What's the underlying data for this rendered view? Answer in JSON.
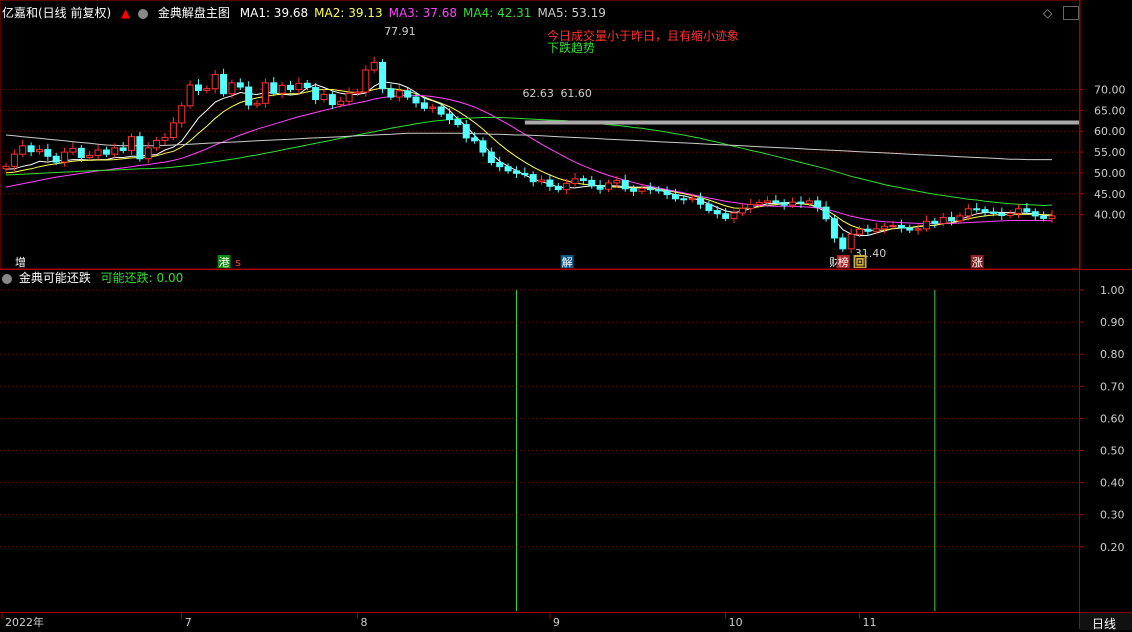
{
  "header": {
    "stock": "亿嘉和(日线 前复权)",
    "indicator": "金典解盘主图",
    "ma": [
      {
        "label": "MA1: 39.68",
        "color": "#ffffff"
      },
      {
        "label": "MA2: 39.13",
        "color": "#ffff55"
      },
      {
        "label": "MA3: 37.68",
        "color": "#ff44ff"
      },
      {
        "label": "MA4: 42.31",
        "color": "#33dd33"
      },
      {
        "label": "MA5: 53.19",
        "color": "#cccccc"
      }
    ]
  },
  "sub_header": {
    "indicator": "金典可能还跌",
    "value_label": "可能还跌: 0.00"
  },
  "annotations": {
    "notice_red": "今日成交量小于昨日，且有缩小迹象",
    "notice_green": "下跌趋势",
    "high_label": "77.91",
    "low_label": "31.40",
    "band_label_1": "62.63",
    "band_label_2": "61.60"
  },
  "markers": [
    {
      "text": "增",
      "color": "#ffffff",
      "bg": "#000000",
      "at": "2022-06-03"
    },
    {
      "text": "港",
      "color": "#ffffff",
      "bg": "#118811",
      "at": "2022-07-08"
    },
    {
      "text": "s",
      "color": "#ff4444",
      "bg": "#000000",
      "at": "2022-07-12"
    },
    {
      "text": "解",
      "color": "#ffffff",
      "bg": "#115588",
      "at": "2022-09-05"
    },
    {
      "text": "财",
      "color": "#ffffff",
      "bg": "#000000",
      "at": "2022-10-27"
    },
    {
      "text": "榜",
      "color": "#ffffff",
      "bg": "#aa2222",
      "at": "2022-10-28"
    },
    {
      "text": "回",
      "color": "#000000",
      "bg": "#ccaa44",
      "at": "2022-11-01"
    },
    {
      "text": "涨",
      "color": "#ffffff",
      "bg": "#882222",
      "at": "2022-11-21"
    }
  ],
  "date_axis": {
    "labels": [
      "2022年",
      "7",
      "8",
      "9",
      "10",
      "11"
    ],
    "right_label": "日线"
  },
  "chart_data": [
    {
      "type": "candlestick",
      "title": "金典解盘主图",
      "yticks": [
        40,
        45,
        50,
        55,
        60,
        65,
        70
      ],
      "ytick_labels": [
        "40.00",
        "45.00",
        "50.00",
        "55.00",
        "60.00",
        "65.00",
        "70.00"
      ],
      "ylim": [
        29.5,
        80.5
      ],
      "x": [
        "2022-06-01",
        "2022-06-02",
        "2022-06-06",
        "2022-06-07",
        "2022-06-08",
        "2022-06-09",
        "2022-06-10",
        "2022-06-13",
        "2022-06-14",
        "2022-06-15",
        "2022-06-16",
        "2022-06-17",
        "2022-06-20",
        "2022-06-21",
        "2022-06-22",
        "2022-06-23",
        "2022-06-24",
        "2022-06-27",
        "2022-06-28",
        "2022-06-29",
        "2022-06-30",
        "2022-07-01",
        "2022-07-04",
        "2022-07-05",
        "2022-07-06",
        "2022-07-07",
        "2022-07-08",
        "2022-07-11",
        "2022-07-12",
        "2022-07-13",
        "2022-07-14",
        "2022-07-15",
        "2022-07-18",
        "2022-07-19",
        "2022-07-20",
        "2022-07-21",
        "2022-07-22",
        "2022-07-25",
        "2022-07-26",
        "2022-07-27",
        "2022-07-28",
        "2022-07-29",
        "2022-08-01",
        "2022-08-02",
        "2022-08-03",
        "2022-08-04",
        "2022-08-05",
        "2022-08-08",
        "2022-08-09",
        "2022-08-10",
        "2022-08-11",
        "2022-08-12",
        "2022-08-15",
        "2022-08-16",
        "2022-08-17",
        "2022-08-18",
        "2022-08-19",
        "2022-08-22",
        "2022-08-23",
        "2022-08-24",
        "2022-08-25",
        "2022-08-26",
        "2022-08-29",
        "2022-08-30",
        "2022-08-31",
        "2022-09-01",
        "2022-09-02",
        "2022-09-05",
        "2022-09-06",
        "2022-09-07",
        "2022-09-08",
        "2022-09-09",
        "2022-09-13",
        "2022-09-14",
        "2022-09-15",
        "2022-09-16",
        "2022-09-19",
        "2022-09-20",
        "2022-09-21",
        "2022-09-22",
        "2022-09-23",
        "2022-09-26",
        "2022-09-27",
        "2022-09-28",
        "2022-09-29",
        "2022-09-30",
        "2022-10-10",
        "2022-10-11",
        "2022-10-12",
        "2022-10-13",
        "2022-10-14",
        "2022-10-17",
        "2022-10-18",
        "2022-10-19",
        "2022-10-20",
        "2022-10-21",
        "2022-10-24",
        "2022-10-25",
        "2022-10-26",
        "2022-10-27",
        "2022-10-28",
        "2022-10-31",
        "2022-11-01",
        "2022-11-02",
        "2022-11-03",
        "2022-11-04",
        "2022-11-07",
        "2022-11-08",
        "2022-11-09",
        "2022-11-10",
        "2022-11-11",
        "2022-11-14",
        "2022-11-15",
        "2022-11-16",
        "2022-11-17",
        "2022-11-18",
        "2022-11-21",
        "2022-11-22",
        "2022-11-23",
        "2022-11-24",
        "2022-11-25",
        "2022-11-28",
        "2022-11-29",
        "2022-11-30",
        "2022-12-01",
        "2022-12-02"
      ],
      "close": [
        51.6,
        54.5,
        56.5,
        55.1,
        55.6,
        54.0,
        52.6,
        55.0,
        55.9,
        53.7,
        54.2,
        55.5,
        54.5,
        56.0,
        55.4,
        58.7,
        53.4,
        56.0,
        57.8,
        58.5,
        62.0,
        66.1,
        71.1,
        69.8,
        70.2,
        73.6,
        69.0,
        71.6,
        70.6,
        66.3,
        66.7,
        71.6,
        69.1,
        71.0,
        70.0,
        71.5,
        70.5,
        67.6,
        68.8,
        66.4,
        67.2,
        69.1,
        69.4,
        74.7,
        76.5,
        70.2,
        68.2,
        69.7,
        68.2,
        66.8,
        65.5,
        65.8,
        64.1,
        62.8,
        61.6,
        58.4,
        57.7,
        55.0,
        52.5,
        51.5,
        50.5,
        49.9,
        49.6,
        47.9,
        48.3,
        46.8,
        46.0,
        47.5,
        48.6,
        48.2,
        46.9,
        46.1,
        47.6,
        48.2,
        46.2,
        45.6,
        46.3,
        46.0,
        45.7,
        44.8,
        43.8,
        43.6,
        43.9,
        42.5,
        41.0,
        40.2,
        39.1,
        40.4,
        41.5,
        42.4,
        42.9,
        43.3,
        42.9,
        42.3,
        43.0,
        42.7,
        43.3,
        41.8,
        39.0,
        34.4,
        31.8,
        35.3,
        36.5,
        36.0,
        36.6,
        37.2,
        37.4,
        36.8,
        36.3,
        36.6,
        38.4,
        37.9,
        39.3,
        38.5,
        39.7,
        41.4,
        41.2,
        40.6,
        40.3,
        39.8,
        40.3,
        41.4,
        40.7,
        39.7,
        39.1,
        39.7
      ],
      "ma_series": [
        {
          "label": "MA1",
          "color": "#ffffff",
          "values": [
            50.9,
            51.0,
            51.6,
            52.0,
            52.8,
            52.6,
            53.0,
            52.9,
            53.2,
            53.2,
            53.1,
            53.2,
            53.2,
            53.7,
            53.7,
            54.0,
            54.0,
            54.3,
            54.4,
            55.5,
            56.2,
            57.6,
            60.4,
            63.2,
            65.0,
            67.0,
            67.9,
            68.5,
            69.3,
            69.0,
            68.8,
            69.3,
            69.2,
            68.9,
            68.7,
            68.9,
            70.4,
            71.2,
            70.5,
            69.7,
            69.1,
            68.8,
            68.8,
            69.2,
            70.8,
            71.9,
            71.6,
            71.3,
            70.5,
            69.3,
            67.9,
            67.3,
            66.5,
            65.0,
            62.9,
            61.2,
            59.0,
            56.9,
            54.6,
            52.8,
            51.6,
            50.6,
            49.5,
            48.6,
            47.9,
            47.3,
            46.6,
            46.5,
            46.4,
            46.7,
            46.9,
            47.0,
            46.9,
            46.9,
            46.7,
            46.6,
            46.6,
            46.6,
            46.0,
            45.3,
            44.8,
            44.5,
            44.0,
            43.4,
            42.6,
            41.7,
            40.9,
            40.5,
            40.8,
            41.5,
            42.1,
            42.6,
            42.7,
            42.9,
            42.9,
            42.6,
            42.4,
            41.7,
            40.6,
            38.7,
            36.4,
            35.3,
            35.0,
            35.0,
            35.6,
            36.1,
            36.7,
            36.8,
            36.9,
            37.2,
            37.4,
            37.4,
            37.9,
            38.0,
            38.9,
            39.5,
            40.2,
            40.5,
            40.6,
            40.5,
            40.5,
            40.4,
            40.3,
            40.2,
            39.9,
            39.7
          ]
        },
        {
          "label": "MA2",
          "color": "#ffff55",
          "values": [
            50.0,
            50.2,
            50.6,
            51.0,
            51.5,
            51.9,
            52.2,
            52.5,
            52.8,
            53.0,
            53.0,
            53.1,
            53.1,
            53.2,
            53.4,
            53.6,
            53.7,
            53.8,
            54.1,
            54.7,
            55.2,
            56.2,
            57.7,
            59.5,
            61.2,
            63.1,
            64.7,
            65.9,
            66.9,
            67.5,
            68.0,
            68.4,
            68.7,
            68.9,
            69.0,
            69.0,
            69.4,
            69.9,
            70.0,
            70.0,
            69.7,
            69.4,
            69.3,
            69.5,
            70.0,
            70.4,
            70.2,
            70.0,
            69.6,
            69.0,
            68.2,
            67.4,
            66.7,
            65.9,
            64.8,
            63.5,
            62.1,
            60.5,
            58.7,
            56.9,
            55.3,
            53.9,
            52.6,
            51.4,
            50.4,
            49.5,
            48.7,
            48.1,
            47.6,
            47.3,
            47.1,
            46.9,
            46.7,
            46.6,
            46.5,
            46.4,
            46.4,
            46.3,
            46.1,
            45.8,
            45.4,
            45.0,
            44.6,
            44.1,
            43.5,
            42.8,
            42.1,
            41.6,
            41.5,
            41.6,
            41.9,
            42.2,
            42.4,
            42.6,
            42.7,
            42.6,
            42.4,
            42.0,
            41.2,
            39.9,
            38.5,
            37.4,
            36.7,
            36.3,
            36.2,
            36.3,
            36.6,
            36.8,
            36.9,
            37.1,
            37.3,
            37.5,
            37.8,
            38.0,
            38.5,
            39.0,
            39.4,
            39.7,
            39.9,
            40.0,
            40.1,
            40.1,
            40.1,
            40.1,
            40.0,
            39.9
          ]
        },
        {
          "label": "MA3",
          "color": "#ff44ff",
          "values": [
            46.6,
            47.0,
            47.4,
            47.8,
            48.2,
            48.6,
            49.0,
            49.3,
            49.6,
            49.9,
            50.2,
            50.5,
            50.7,
            51.0,
            51.2,
            51.5,
            51.8,
            52.0,
            52.3,
            52.6,
            53.0,
            53.5,
            54.2,
            55.0,
            55.8,
            56.7,
            57.5,
            58.3,
            59.1,
            59.8,
            60.5,
            61.1,
            61.7,
            62.3,
            62.9,
            63.5,
            64.0,
            64.5,
            65.0,
            65.5,
            66.0,
            66.4,
            66.8,
            67.2,
            67.7,
            68.1,
            68.3,
            68.5,
            68.6,
            68.6,
            68.5,
            68.3,
            68.0,
            67.6,
            67.1,
            66.5,
            65.8,
            64.9,
            63.9,
            62.8,
            61.7,
            60.5,
            59.3,
            58.1,
            56.9,
            55.8,
            54.7,
            53.6,
            52.6,
            51.7,
            50.9,
            50.1,
            49.4,
            48.8,
            48.2,
            47.7,
            47.2,
            46.8,
            46.4,
            46.0,
            45.6,
            45.2,
            44.8,
            44.4,
            44.0,
            43.6,
            43.2,
            42.9,
            42.6,
            42.4,
            42.2,
            42.1,
            42.0,
            42.0,
            42.0,
            41.9,
            41.8,
            41.6,
            41.3,
            40.8,
            40.2,
            39.6,
            39.2,
            38.8,
            38.5,
            38.3,
            38.2,
            38.1,
            38.0,
            37.9,
            37.9,
            37.9,
            37.9,
            37.9,
            38.0,
            38.1,
            38.2,
            38.3,
            38.4,
            38.5,
            38.6,
            38.6,
            38.6,
            38.6,
            38.6,
            38.5
          ]
        },
        {
          "label": "MA4",
          "color": "#33dd33",
          "values": [
            49.5,
            49.6,
            49.7,
            49.8,
            49.9,
            50.0,
            50.1,
            50.2,
            50.3,
            50.4,
            50.5,
            50.6,
            50.6,
            50.7,
            50.8,
            50.9,
            51.0,
            51.0,
            51.1,
            51.2,
            51.4,
            51.6,
            51.8,
            52.1,
            52.4,
            52.7,
            53.0,
            53.3,
            53.6,
            54.0,
            54.3,
            54.7,
            55.1,
            55.5,
            55.9,
            56.3,
            56.7,
            57.1,
            57.5,
            57.9,
            58.3,
            58.7,
            59.1,
            59.5,
            59.9,
            60.3,
            60.7,
            61.1,
            61.4,
            61.8,
            62.1,
            62.4,
            62.6,
            62.8,
            63.0,
            63.1,
            63.2,
            63.3,
            63.3,
            63.3,
            63.2,
            63.1,
            63.0,
            62.9,
            62.8,
            62.7,
            62.6,
            62.5,
            62.3,
            62.2,
            62.0,
            61.8,
            61.6,
            61.4,
            61.2,
            60.9,
            60.7,
            60.4,
            60.1,
            59.8,
            59.4,
            59.1,
            58.7,
            58.3,
            57.8,
            57.4,
            56.9,
            56.4,
            55.9,
            55.4,
            55.0,
            54.5,
            54.0,
            53.5,
            53.0,
            52.5,
            52.0,
            51.5,
            51.0,
            50.4,
            49.8,
            49.2,
            48.7,
            48.2,
            47.7,
            47.2,
            46.8,
            46.4,
            46.0,
            45.6,
            45.2,
            44.9,
            44.6,
            44.3,
            44.0,
            43.7,
            43.5,
            43.2,
            43.0,
            42.8,
            42.6,
            42.5,
            42.4,
            42.3,
            42.2,
            42.3
          ]
        },
        {
          "label": "MA5",
          "color": "#cccccc",
          "values": [
            59.1,
            58.9,
            58.7,
            58.5,
            58.3,
            58.1,
            57.9,
            57.7,
            57.5,
            57.3,
            57.1,
            56.9,
            56.7,
            56.6,
            56.5,
            56.5,
            56.5,
            56.5,
            56.5,
            56.6,
            56.7,
            56.8,
            56.9,
            57.0,
            57.1,
            57.2,
            57.3,
            57.4,
            57.5,
            57.6,
            57.7,
            57.8,
            57.9,
            58.0,
            58.1,
            58.2,
            58.3,
            58.4,
            58.5,
            58.6,
            58.7,
            58.8,
            58.9,
            59.0,
            59.1,
            59.2,
            59.3,
            59.4,
            59.5,
            59.5,
            59.5,
            59.5,
            59.5,
            59.5,
            59.5,
            59.5,
            59.4,
            59.4,
            59.3,
            59.3,
            59.2,
            59.1,
            59.1,
            59.0,
            58.9,
            58.8,
            58.7,
            58.6,
            58.5,
            58.4,
            58.3,
            58.2,
            58.1,
            58.0,
            57.9,
            57.8,
            57.7,
            57.6,
            57.5,
            57.4,
            57.3,
            57.2,
            57.1,
            57.0,
            56.9,
            56.8,
            56.7,
            56.6,
            56.5,
            56.4,
            56.3,
            56.2,
            56.1,
            56.0,
            55.9,
            55.8,
            55.7,
            55.6,
            55.5,
            55.4,
            55.3,
            55.2,
            55.1,
            55.0,
            54.9,
            54.8,
            54.7,
            54.6,
            54.5,
            54.4,
            54.3,
            54.2,
            54.1,
            54.0,
            53.9,
            53.8,
            53.7,
            53.6,
            53.5,
            53.4,
            53.3,
            53.3,
            53.2,
            53.2,
            53.2,
            53.19
          ]
        }
      ],
      "band": {
        "value": 62.1,
        "color": "#aaaaaa"
      }
    },
    {
      "type": "bar",
      "title": "金典可能还跌",
      "yticks": [
        0.2,
        0.3,
        0.4,
        0.5,
        0.6,
        0.7,
        0.8,
        0.9,
        1.0
      ],
      "ytick_labels": [
        "0.20",
        "0.30",
        "0.40",
        "0.50",
        "0.60",
        "0.70",
        "0.80",
        "0.90",
        "1.00"
      ],
      "ylim": [
        0,
        1.05
      ],
      "signals": [
        {
          "x": "2022-08-26",
          "value": 1.0
        },
        {
          "x": "2022-11-14",
          "value": 1.0
        }
      ]
    }
  ]
}
